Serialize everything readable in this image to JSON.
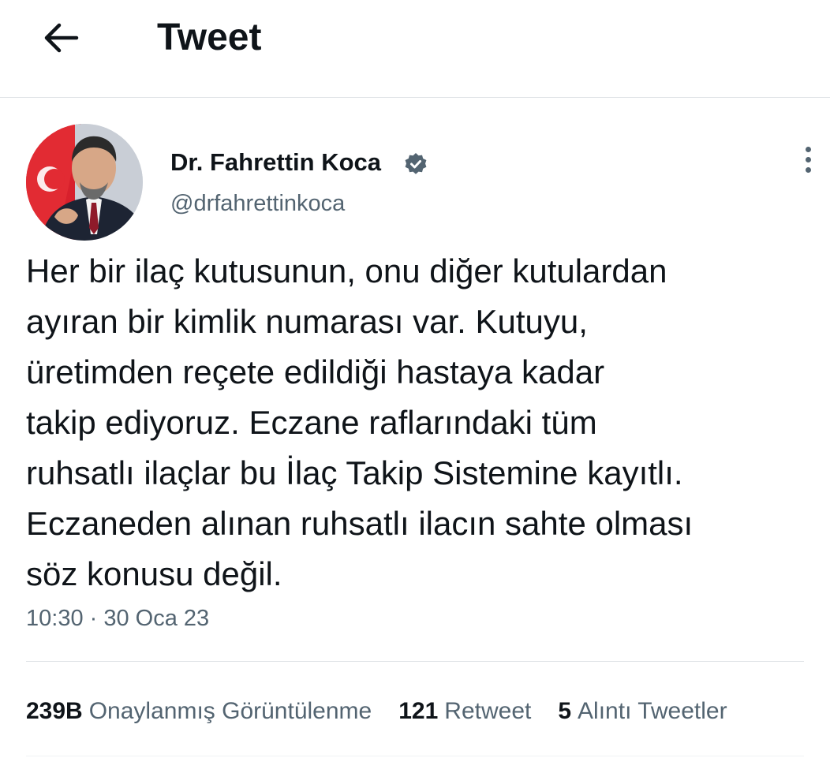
{
  "header": {
    "back_icon": "arrow-left-icon",
    "title": "Tweet"
  },
  "tweet": {
    "author": {
      "name": "Dr. Fahrettin Koca",
      "handle": "@drfahrettinkoca",
      "verified": true,
      "verified_icon": "verified-badge-icon",
      "verified_color": "#536471"
    },
    "more_icon": "more-vertical-icon",
    "text": "Her bir ilaç kutusunun, onu diğer kutulardan\nayıran bir kimlik numarası var. Kutuyu,\nüretimden reçete edildiği hastaya kadar\ntakip ediyoruz. Eczane raflarındaki tüm\nruhsatlı ilaçlar bu İlaç Takip Sistemine kayıtlı.\nEczaneden alınan ruhsatlı ilacın sahte olması\nsöz konusu değil.",
    "timestamp": "10:30 · 30 Oca 23",
    "stats": [
      {
        "value": "239B",
        "label": "Onaylanmış Görüntülenme"
      },
      {
        "value": "121",
        "label": "Retweet"
      },
      {
        "value": "5",
        "label": "Alıntı Tweetler"
      }
    ]
  },
  "colors": {
    "text_primary": "#0f1419",
    "text_secondary": "#536471",
    "divider": "#dfe3e6"
  }
}
